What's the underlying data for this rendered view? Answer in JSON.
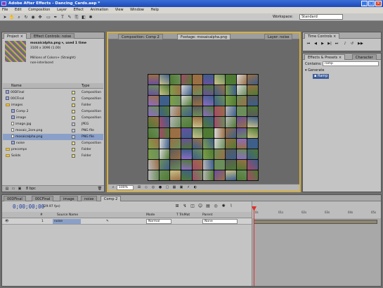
{
  "window": {
    "title": "Adobe After Effects - Dancing_Cards.aep *",
    "min": "_",
    "max": "□",
    "close": "✕"
  },
  "menu": [
    "File",
    "Edit",
    "Composition",
    "Layer",
    "Effect",
    "Animation",
    "View",
    "Window",
    "Help"
  ],
  "workspace": {
    "label": "Workspace:",
    "value": "Standard"
  },
  "project": {
    "tabs": [
      "Project ×",
      "Effect Controls: noise"
    ],
    "info": {
      "name": "mosaicalpha.png ▾, used 1 time",
      "size": "3100 x 3096 (1.00)",
      "colors": "Millions of Colors+ (Straight)",
      "interp": "non-interlaced"
    },
    "columns": {
      "name": "Name",
      "type": "Type"
    },
    "rows": [
      {
        "name": "00DFinal",
        "type": "Composition",
        "kind": "comp",
        "indent": 0
      },
      {
        "name": "00CFinal",
        "type": "Composition",
        "kind": "comp",
        "indent": 0
      },
      {
        "name": "images",
        "type": "Folder",
        "kind": "folder",
        "indent": 0
      },
      {
        "name": "Comp 2",
        "type": "Composition",
        "kind": "comp",
        "indent": 1
      },
      {
        "name": "image",
        "type": "Composition",
        "kind": "comp",
        "indent": 1
      },
      {
        "name": "image.jpg",
        "type": "JPEG",
        "kind": "file",
        "indent": 1
      },
      {
        "name": "mosaic_2ore.png",
        "type": "PNG file",
        "kind": "file",
        "indent": 1
      },
      {
        "name": "mosaicalpha.png",
        "type": "PNG file",
        "kind": "file",
        "indent": 1,
        "selected": true
      },
      {
        "name": "noise",
        "type": "Composition",
        "kind": "comp",
        "indent": 1
      },
      {
        "name": "precomps",
        "type": "Folder",
        "kind": "folder",
        "indent": 0
      },
      {
        "name": "Solids",
        "type": "Folder",
        "kind": "folder",
        "indent": 0
      }
    ],
    "footer": "8 bpc"
  },
  "composition": {
    "tabs": [
      "Composition: Comp 2",
      "Footage: mosaicalpha.png",
      "Layer: noise"
    ],
    "zoom": "100%"
  },
  "time_controls": {
    "tab": "Time Controls ×"
  },
  "effects": {
    "tabs": [
      "Effects & Presets ×",
      "Character"
    ],
    "contains_label": "Contains:",
    "contains_value": "ramp",
    "category": "Generate",
    "item": "Ramp"
  },
  "timeline": {
    "tabs": [
      "00DFinal",
      "00CFinal",
      "image",
      "noise",
      "Comp 2"
    ],
    "current_time": "0;00;00;00",
    "fps": "(29.97 fps)",
    "columns": [
      "#",
      "Source Name",
      "Mode",
      "T TrkMat",
      "Parent"
    ],
    "layer": {
      "index": "1",
      "name": "noise",
      "mode": "Normal",
      "parent": "None"
    },
    "ruler": [
      "0s",
      "01s",
      "02s",
      "03s",
      "04s",
      "05s"
    ]
  }
}
